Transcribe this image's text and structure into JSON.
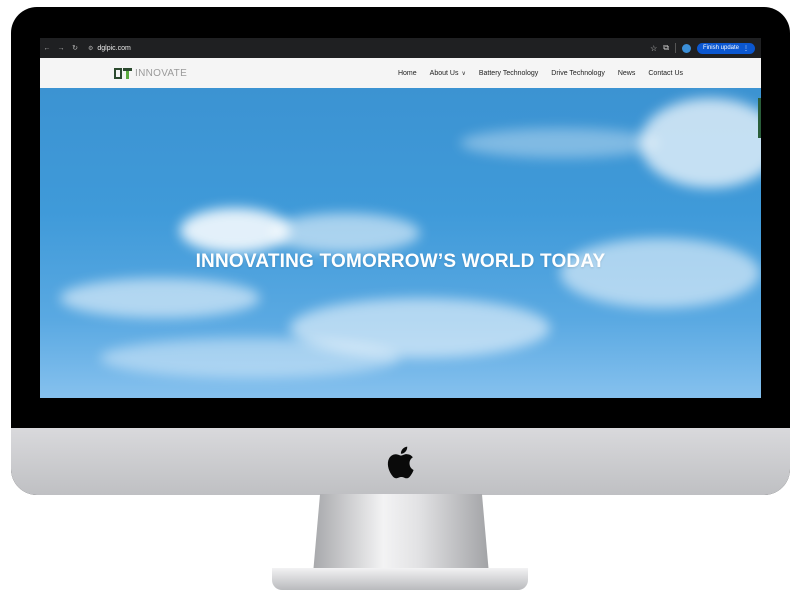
{
  "browser": {
    "url": "dglpic.com",
    "update_label": "Finish update",
    "profile_initial": "",
    "back_icon": "back-arrow-icon",
    "forward_icon": "forward-arrow-icon",
    "reload_icon": "reload-icon"
  },
  "site": {
    "logo_text": "INNOVATE",
    "nav": [
      {
        "label": "Home"
      },
      {
        "label": "About Us"
      },
      {
        "label": "Battery Technology"
      },
      {
        "label": "Drive Technology"
      },
      {
        "label": "News"
      },
      {
        "label": "Contact Us"
      }
    ]
  },
  "hero": {
    "title": "INNOVATING TOMORROW’S WORLD TODAY"
  },
  "colors": {
    "bezel": "#000000",
    "browser_bar": "#1f2022",
    "update_button": "#0b57d0",
    "sky": "#3f9ad9"
  }
}
